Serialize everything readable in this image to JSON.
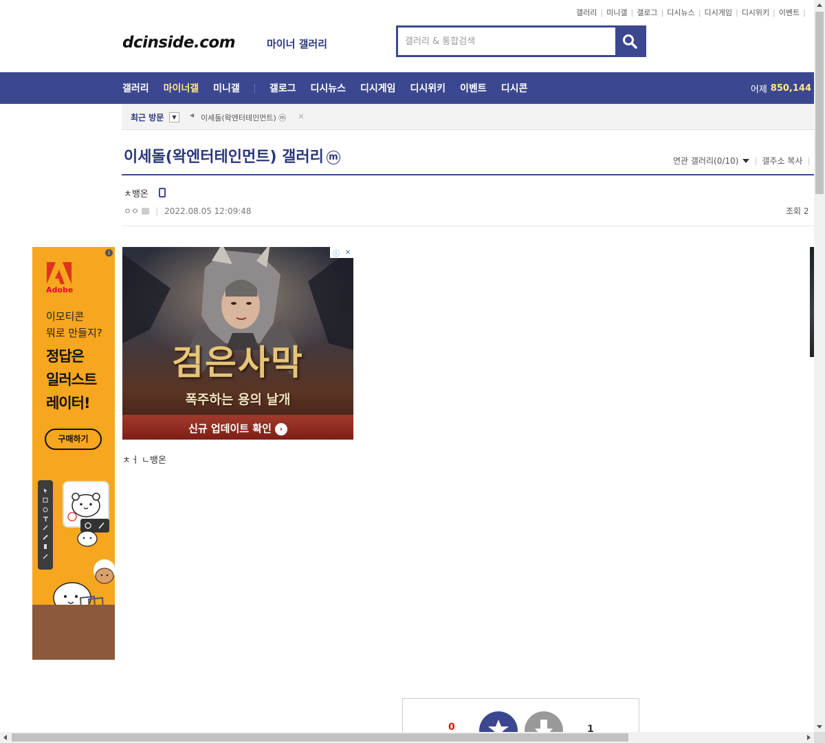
{
  "top_util": [
    "갤러리",
    "미니갤",
    "갤로그",
    "디시뉴스",
    "디시게임",
    "디시위키",
    "이벤트"
  ],
  "header": {
    "logo": "dcinside.com",
    "logo_sub": "마이너 갤러리",
    "search_placeholder": "갤러리 & 통합검색"
  },
  "gnb": {
    "items": [
      "갤러리",
      "마이너갤",
      "미니갤",
      "갤로그",
      "디시뉴스",
      "디시게임",
      "디시위키",
      "이벤트",
      "디시콘"
    ],
    "active_index": 1,
    "yesterday_label": "어제",
    "yesterday_count": "850,144"
  },
  "visit": {
    "label": "최근 방문",
    "item": "이세돌(왁엔터테인먼트)",
    "item_badge": "ⓜ",
    "close": "×"
  },
  "gallery": {
    "title": "이세돌(왁엔터테인먼트) 갤러리",
    "badge": "m",
    "related": "연관 갤러리(0/10)",
    "copy_address": "갤주소 복사"
  },
  "post": {
    "writer": "ㅊ뱅온",
    "nickname": "ㅇㅇ",
    "datetime": "2022.08.05 12:09:48",
    "views_label": "조회 2",
    "content": "ㅊㅓ ㄴ뱅온"
  },
  "left_ad": {
    "brand": "Adobe",
    "question": "이모티콘\n뭐로 만들지?",
    "answer": "정답은\n일러스트\n레이터!",
    "button": "구매하기",
    "info": "i"
  },
  "center_ad": {
    "headline": "검은사막",
    "subline": "폭주하는 용의 날개",
    "cta": "신규 업데이트 확인",
    "cta_arrow": "›",
    "adchoice_i": "ⓘ",
    "adchoice_x": "✕"
  },
  "recommend": {
    "up_count": "0",
    "down_count": "1"
  },
  "colors": {
    "brand_navy": "#3b4890",
    "title_navy": "#29367c",
    "active_yellow": "#ffe88a",
    "ad_orange": "#f6a61f"
  }
}
